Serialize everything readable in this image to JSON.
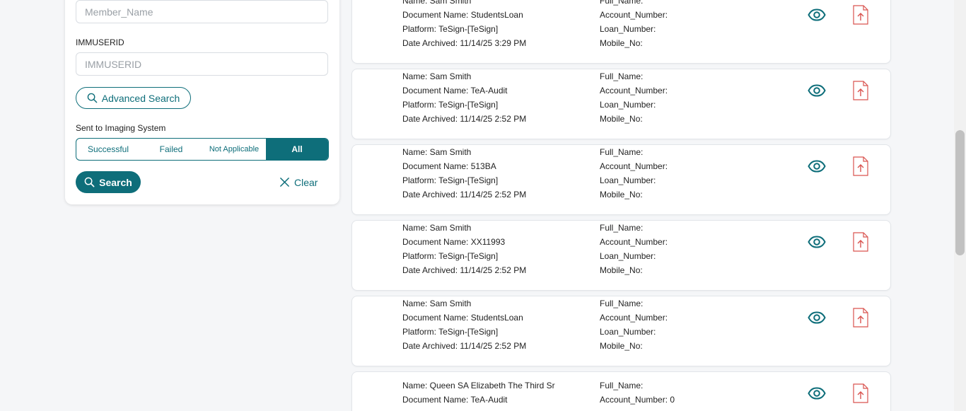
{
  "filters": {
    "member_name": {
      "placeholder": "Member_Name",
      "value": ""
    },
    "immuserid": {
      "label": "IMMUSERID",
      "placeholder": "IMMUSERID",
      "value": ""
    },
    "advanced_search_label": "Advanced Search",
    "sent_to_imaging": {
      "label": "Sent to Imaging System",
      "options": [
        "Successful",
        "Failed",
        "Not Applicable",
        "All"
      ],
      "selected": "All"
    },
    "search_label": "Search",
    "clear_label": "Clear"
  },
  "results": [
    {
      "name": "Name: Sam Smith",
      "document": "Document Name: StudentsLoan",
      "platform": "Platform: TeSign-[TeSign]",
      "date": "Date Archived: 11/14/25 3:29 PM",
      "full_name": "Full_Name:",
      "account": "Account_Number:",
      "loan": "Loan_Number:",
      "mobile": "Mobile_No:"
    },
    {
      "name": "Name: Sam Smith",
      "document": "Document Name: TeA-Audit",
      "platform": "Platform: TeSign-[TeSign]",
      "date": "Date Archived: 11/14/25 2:52 PM",
      "full_name": "Full_Name:",
      "account": "Account_Number:",
      "loan": "Loan_Number:",
      "mobile": "Mobile_No:"
    },
    {
      "name": "Name: Sam Smith",
      "document": "Document Name: 513BA",
      "platform": "Platform: TeSign-[TeSign]",
      "date": "Date Archived: 11/14/25 2:52 PM",
      "full_name": "Full_Name:",
      "account": "Account_Number:",
      "loan": "Loan_Number:",
      "mobile": "Mobile_No:"
    },
    {
      "name": "Name: Sam Smith",
      "document": "Document Name: XX11993",
      "platform": "Platform: TeSign-[TeSign]",
      "date": "Date Archived: 11/14/25 2:52 PM",
      "full_name": "Full_Name:",
      "account": "Account_Number:",
      "loan": "Loan_Number:",
      "mobile": "Mobile_No:"
    },
    {
      "name": "Name: Sam Smith",
      "document": "Document Name: StudentsLoan",
      "platform": "Platform: TeSign-[TeSign]",
      "date": "Date Archived: 11/14/25 2:52 PM",
      "full_name": "Full_Name:",
      "account": "Account_Number:",
      "loan": "Loan_Number:",
      "mobile": "Mobile_No:"
    },
    {
      "name": "Name: Queen SA Elizabeth The Third Sr",
      "document": "Document Name: TeA-Audit",
      "platform": "",
      "date": "",
      "full_name": "Full_Name:",
      "account": "Account_Number: 0",
      "loan": "",
      "mobile": ""
    }
  ],
  "icons": {
    "view": "eye-icon",
    "pdf": "pdf-upload-icon",
    "search": "search-icon",
    "clear": "close-icon"
  },
  "colors": {
    "accent": "#0e6e7a",
    "pdf_red": "#d9534f",
    "background": "#f5f6f8"
  }
}
